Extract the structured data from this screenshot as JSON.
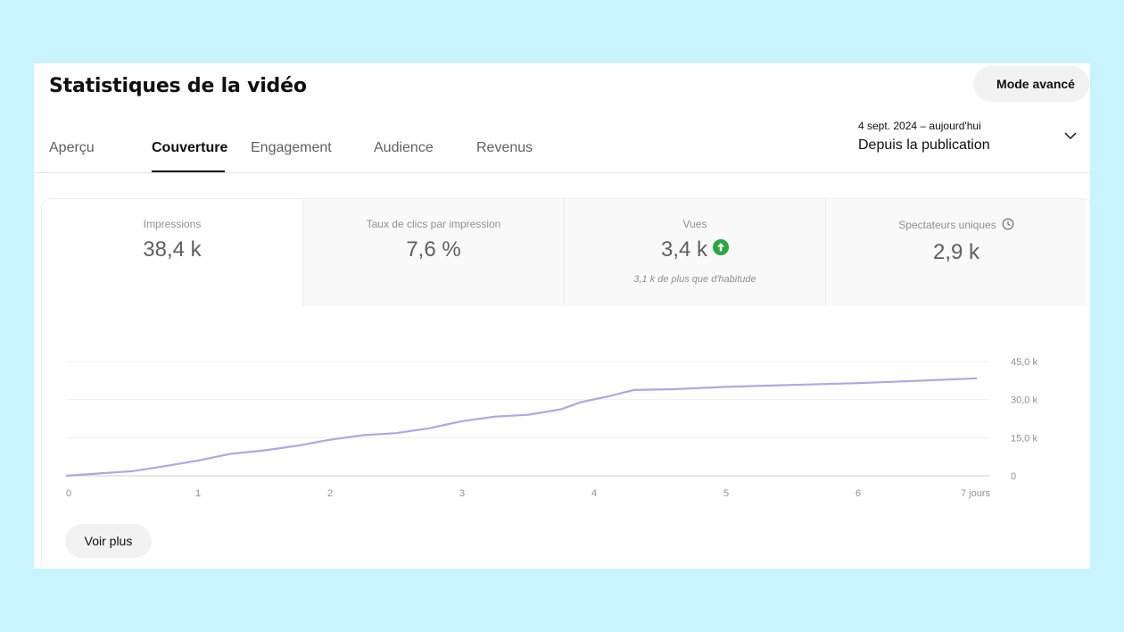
{
  "header": {
    "title": "Statistiques de la vidéo",
    "mode_button": "Mode avancé"
  },
  "tabs": [
    {
      "label": "Aperçu",
      "active": false
    },
    {
      "label": "Couverture",
      "active": true
    },
    {
      "label": "Engagement",
      "active": false
    },
    {
      "label": "Audience",
      "active": false
    },
    {
      "label": "Revenus",
      "active": false
    }
  ],
  "date_range": {
    "range": "4 sept. 2024 – aujourd'hui",
    "label": "Depuis la publication"
  },
  "metrics": [
    {
      "label": "Impressions",
      "value": "38,4 k"
    },
    {
      "label": "Taux de clics par impression",
      "value": "7,6 %"
    },
    {
      "label": "Vues",
      "value": "3,4 k",
      "note": "3,1 k de plus que d'habitude"
    },
    {
      "label": "Spectateurs uniques",
      "value": "2,9 k"
    }
  ],
  "chart_data": {
    "type": "line",
    "xlabel": "",
    "ylabel": "",
    "x_tick_labels": [
      "0",
      "1",
      "2",
      "3",
      "4",
      "5",
      "6",
      "7 jours"
    ],
    "y_tick_labels": [
      "0",
      "15,0 k",
      "30,0 k",
      "45,0 k"
    ],
    "xlim": [
      0,
      7
    ],
    "ylim": [
      0,
      45000
    ],
    "grid": true,
    "color": "#b1a5e4",
    "series": [
      {
        "x": [
          0,
          0.25,
          0.5,
          0.75,
          1,
          1.25,
          1.5,
          1.75,
          2,
          2.25,
          2.5,
          2.75,
          3,
          3.25,
          3.5,
          3.75,
          3.9,
          4.1,
          4.3,
          4.6,
          5,
          5.5,
          6,
          6.5,
          6.9
        ],
        "y": [
          0,
          900,
          1800,
          3800,
          6000,
          8700,
          10000,
          11800,
          14200,
          16000,
          16800,
          18700,
          21500,
          23300,
          24000,
          26200,
          29000,
          31200,
          33800,
          34100,
          35000,
          35800,
          36500,
          37500,
          38400
        ]
      }
    ]
  },
  "actions": {
    "see_more": "Voir plus"
  }
}
